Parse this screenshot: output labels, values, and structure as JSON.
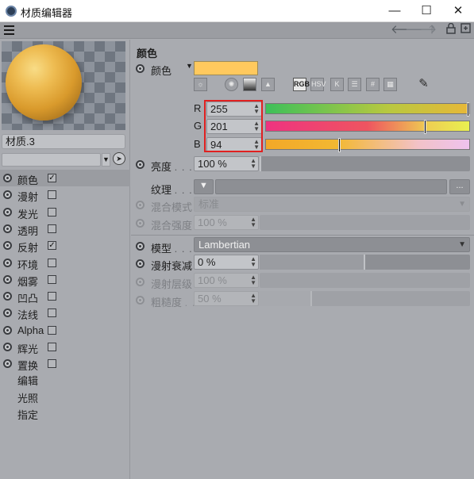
{
  "window": {
    "title": "材质编辑器",
    "minimize": "—",
    "maximize": "☐",
    "close": "✕"
  },
  "toolbar": {
    "icons": [
      "menu-icon",
      "back-arrow-icon",
      "forward-arrow-icon",
      "up-arrow-icon",
      "lock-icon",
      "new-window-icon"
    ]
  },
  "material": {
    "name": "材质.3"
  },
  "channels": [
    {
      "label": "颜色",
      "checked": true,
      "selected": true
    },
    {
      "label": "漫射",
      "checked": false
    },
    {
      "label": "发光",
      "checked": false
    },
    {
      "label": "透明",
      "checked": false
    },
    {
      "label": "反射",
      "checked": true
    },
    {
      "label": "环境",
      "checked": false
    },
    {
      "label": "烟雾",
      "checked": false
    },
    {
      "label": "凹凸",
      "checked": false
    },
    {
      "label": "法线",
      "checked": false
    },
    {
      "label": "Alpha",
      "checked": false
    },
    {
      "label": "辉光",
      "checked": false
    },
    {
      "label": "置换",
      "checked": false
    }
  ],
  "extra_items": [
    "编辑",
    "光照",
    "指定"
  ],
  "color_section": {
    "title": "颜色",
    "color_label": "颜色",
    "color_hex": "#ffc95e",
    "modes": [
      "wheel",
      "spectrum",
      "image",
      "RGB",
      "HSV",
      "K",
      "mixer",
      "#",
      "palette"
    ],
    "active_mode": "RGB",
    "rgb": [
      {
        "channel": "R",
        "value": "255",
        "fraction": 1.0
      },
      {
        "channel": "G",
        "value": "201",
        "fraction": 0.788
      },
      {
        "channel": "B",
        "value": "94",
        "fraction": 0.369
      }
    ],
    "brightness_label": "亮度",
    "brightness_value": "100 %",
    "brightness_fraction": 1.0,
    "texture_label": "纹理",
    "texture_more": "...",
    "blend_mode_label": "混合模式",
    "blend_mode_value": "标准",
    "blend_strength_label": "混合强度",
    "blend_strength_value": "100 %"
  },
  "shading": {
    "model_label": "模型",
    "model_value": "Lambertian",
    "diffuse_falloff_label": "漫射衰减",
    "diffuse_falloff_value": "0 %",
    "diffuse_falloff_fraction": 0.5,
    "diffuse_level_label": "漫射层级",
    "diffuse_level_value": "100 %",
    "roughness_label": "粗糙度",
    "roughness_value": "50 %",
    "roughness_fraction": 0.25
  }
}
